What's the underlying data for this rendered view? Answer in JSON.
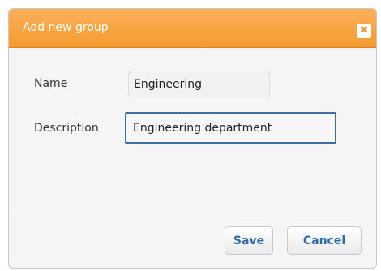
{
  "dialog": {
    "title": "Add new group",
    "close_symbol": "✖",
    "close_icon": "close-icon"
  },
  "form": {
    "name_label": "Name",
    "name_value": "Engineering",
    "description_label": "Description",
    "description_value": "Engineering department"
  },
  "buttons": {
    "save_label": "Save",
    "cancel_label": "Cancel"
  },
  "colors": {
    "titlebar": "#f59a2e",
    "focus_border": "#3f6ea0",
    "button_text": "#2c6aa8"
  }
}
